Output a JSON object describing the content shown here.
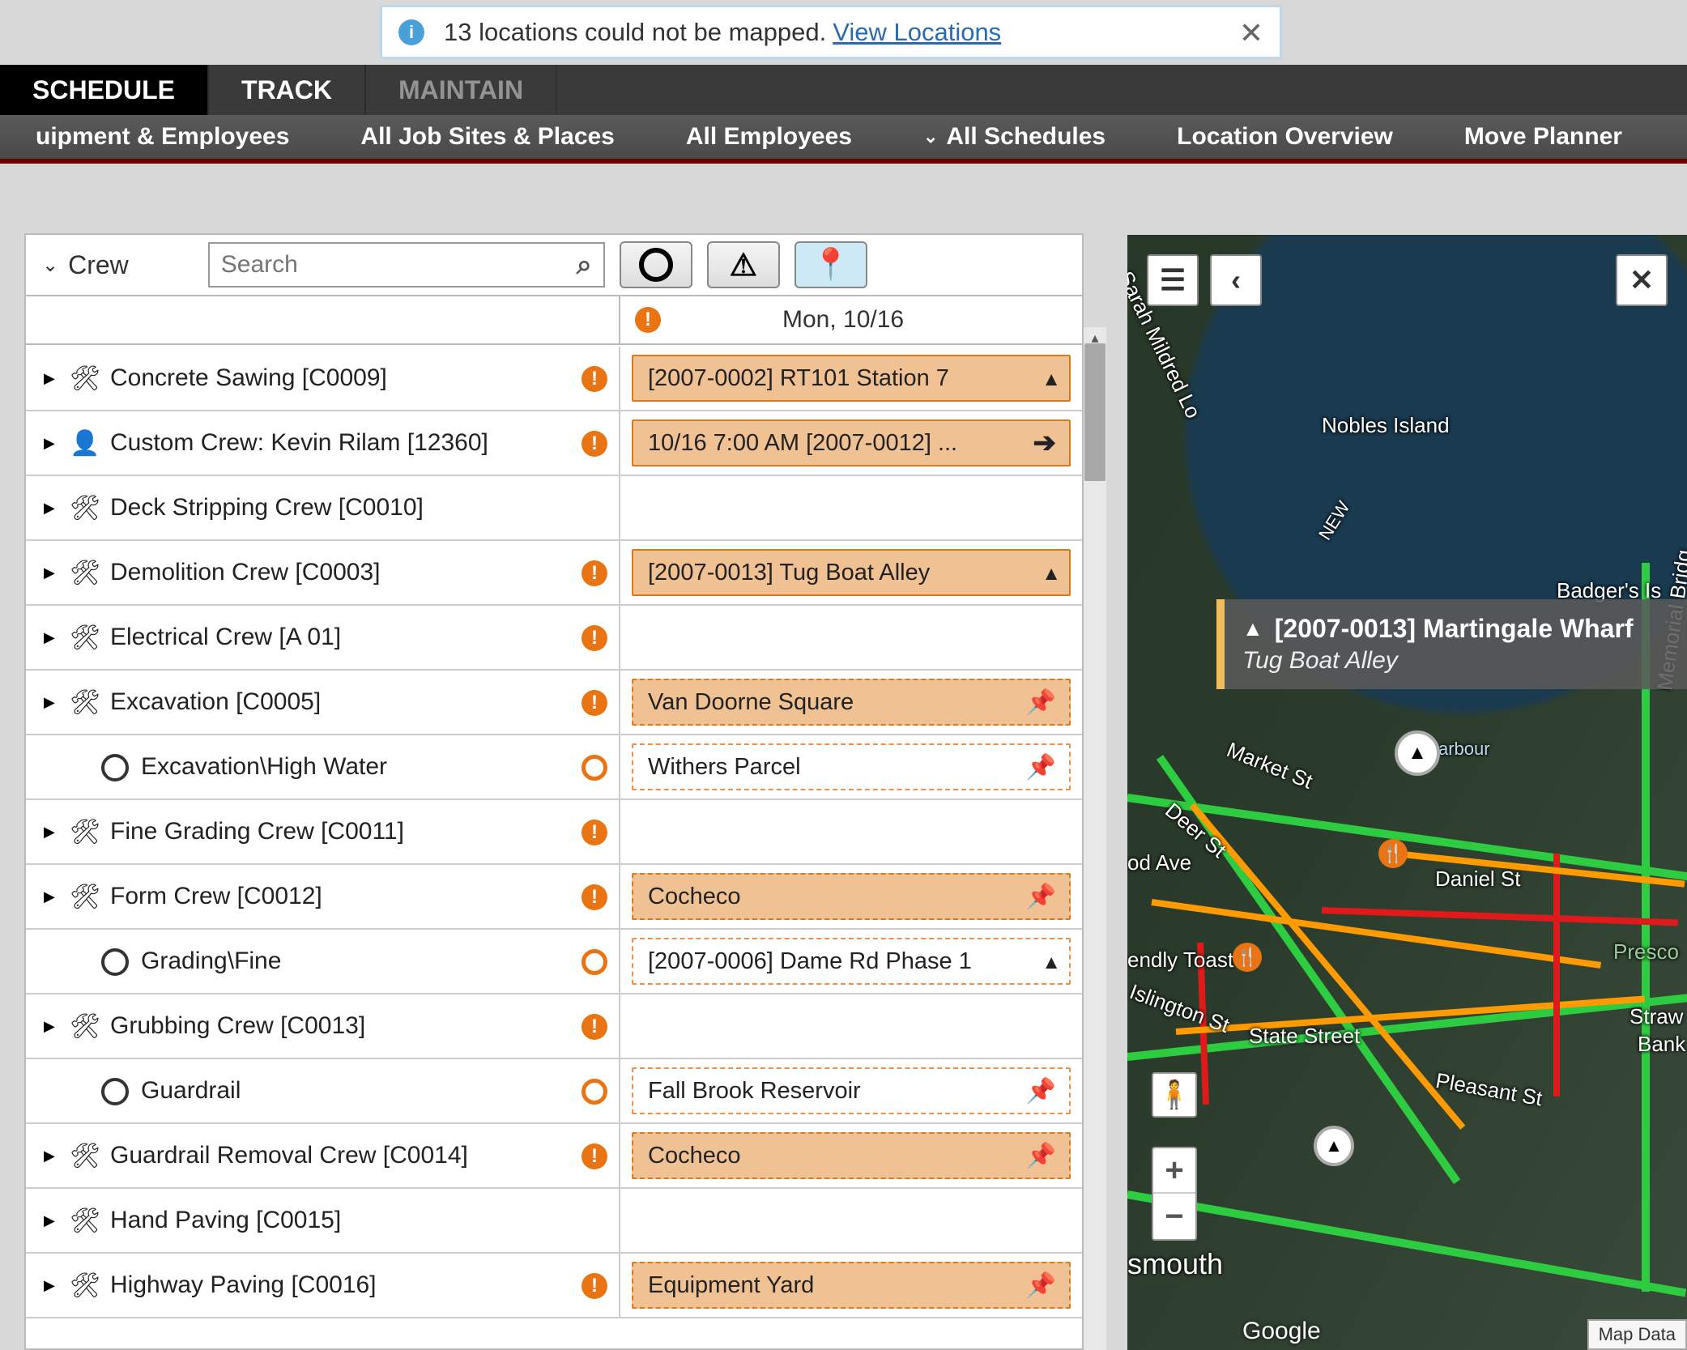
{
  "notification": {
    "text": "13 locations could not be mapped.",
    "link": "View Locations"
  },
  "primary_tabs": {
    "schedule": "SCHEDULE",
    "track": "TRACK",
    "maintain": "MAINTAIN"
  },
  "secondary_nav": {
    "equip_employees": "uipment & Employees",
    "job_sites": "All Job Sites & Places",
    "employees": "All Employees",
    "schedules": "All Schedules",
    "location_overview": "Location Overview",
    "move_planner": "Move Planner"
  },
  "left_panel": {
    "title": "Crew",
    "search_placeholder": "Search",
    "date_header": "Mon, 10/16"
  },
  "rows": [
    {
      "name": "Concrete Sawing [C0009]",
      "icon": "person",
      "expand": true,
      "alert": "solid",
      "chip": {
        "style": "solid",
        "text": "[2007-0002] RT101 Station 7",
        "ricon": "cone"
      }
    },
    {
      "name": "Custom Crew: Kevin Rilam [12360]",
      "icon": "user",
      "expand": true,
      "alert": "solid",
      "chip": {
        "style": "solid",
        "text": "10/16 7:00 AM [2007-0012] ...",
        "ricon": "arrow"
      }
    },
    {
      "name": "Deck Stripping Crew [C0010]",
      "icon": "person",
      "expand": true,
      "alert": null,
      "chip": null
    },
    {
      "name": "Demolition Crew [C0003]",
      "icon": "person",
      "expand": true,
      "alert": "solid",
      "chip": {
        "style": "solid",
        "text": "[2007-0013] Tug Boat Alley",
        "ricon": "cone"
      }
    },
    {
      "name": "Electrical Crew [A 01]",
      "icon": "person",
      "expand": true,
      "alert": "solid",
      "chip": null
    },
    {
      "name": "Excavation [C0005]",
      "icon": "person",
      "expand": true,
      "alert": "solid",
      "chip": {
        "style": "dashed-solid",
        "text": "Van Doorne Square",
        "ricon": "pushpin"
      }
    },
    {
      "name": "Excavation\\High Water",
      "icon": "ring",
      "expand": false,
      "alert": "hollow",
      "chip": {
        "style": "dashed",
        "text": "Withers Parcel",
        "ricon": "pushpin"
      },
      "sub": true
    },
    {
      "name": "Fine Grading Crew [C0011]",
      "icon": "person",
      "expand": true,
      "alert": "solid",
      "chip": null
    },
    {
      "name": "Form Crew [C0012]",
      "icon": "person",
      "expand": true,
      "alert": "solid",
      "chip": {
        "style": "dashed-solid",
        "text": "Cocheco",
        "ricon": "pushpin"
      }
    },
    {
      "name": "Grading\\Fine",
      "icon": "ring",
      "expand": false,
      "alert": "hollow",
      "chip": {
        "style": "dashed",
        "text": "[2007-0006] Dame Rd Phase 1",
        "ricon": "cone"
      },
      "sub": true
    },
    {
      "name": "Grubbing Crew [C0013]",
      "icon": "person",
      "expand": true,
      "alert": "solid",
      "chip": null
    },
    {
      "name": "Guardrail",
      "icon": "ring",
      "expand": false,
      "alert": "hollow",
      "chip": {
        "style": "dashed",
        "text": "Fall Brook Reservoir",
        "ricon": "pushpin"
      },
      "sub": true
    },
    {
      "name": "Guardrail Removal Crew [C0014]",
      "icon": "person",
      "expand": true,
      "alert": "solid",
      "chip": {
        "style": "dashed-solid",
        "text": "Cocheco",
        "ricon": "pushpin"
      }
    },
    {
      "name": "Hand Paving [C0015]",
      "icon": "person",
      "expand": true,
      "alert": null,
      "chip": null
    },
    {
      "name": "Highway Paving [C0016]",
      "icon": "person",
      "expand": true,
      "alert": "solid",
      "chip": {
        "style": "dashed-solid",
        "text": "Equipment Yard",
        "ricon": "pushpin"
      }
    }
  ],
  "map": {
    "callout_title": "[2007-0013] Martingale Wharf",
    "callout_sub": "Tug Boat Alley",
    "labels": {
      "nobles": "Nobles Island",
      "sarah": "Sarah Mildred Lo",
      "badgers": "Badger's Is",
      "market": "Market St",
      "deer": "Deer St",
      "daniel": "Daniel St",
      "state": "State Street",
      "pleasant": "Pleasant St",
      "islington": "Islington St",
      "toast": "endly Toast",
      "od_ave": "od Ave",
      "presco": "Presco",
      "straw": "Straw",
      "bank": "Bank",
      "memorial": "Memorial Bridg",
      "smouth": "smouth",
      "harbour": "arbour",
      "new": "NEW"
    },
    "google": "Google",
    "mapdata": "Map Data"
  }
}
